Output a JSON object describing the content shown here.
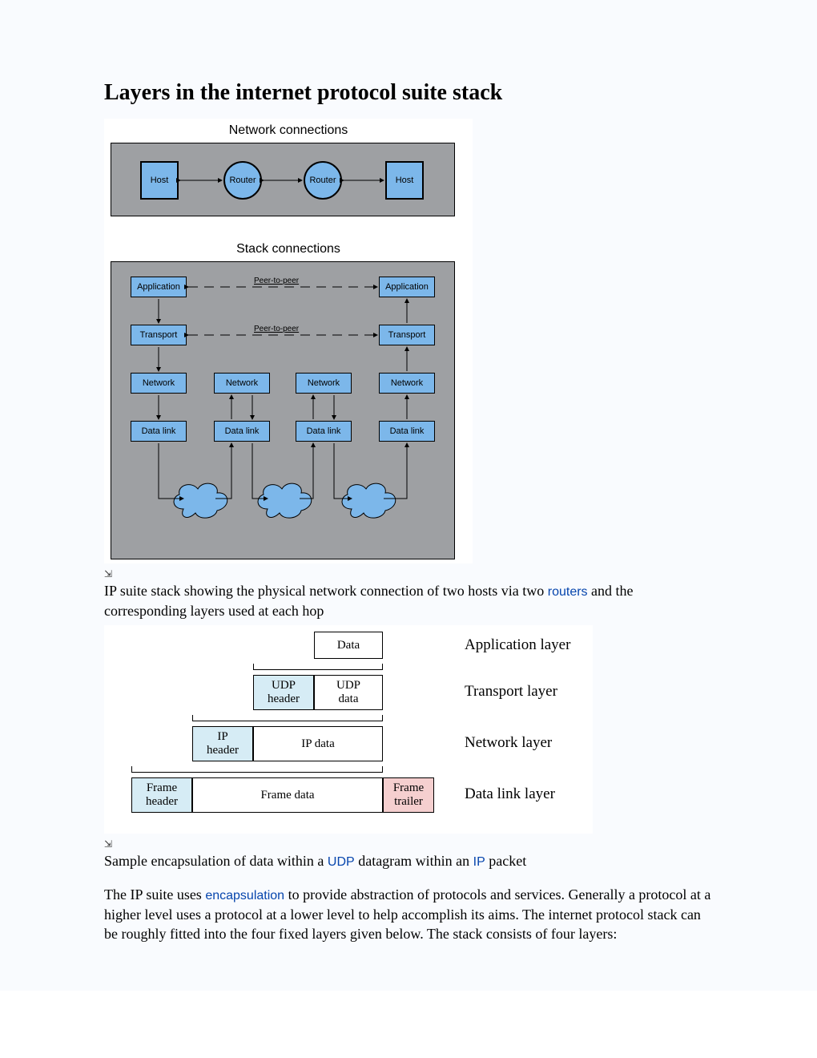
{
  "title": "Layers in the internet protocol suite stack",
  "diagram1": {
    "title_top": "Network connections",
    "title_bottom": "Stack connections",
    "host": "Host",
    "router": "Router",
    "application": "Application",
    "transport": "Transport",
    "network": "Network",
    "datalink": "Data link",
    "peer_label": "Peer-to-peer"
  },
  "caption1_pre": "IP suite stack showing the physical network connection of two hosts via two ",
  "caption1_link": "routers",
  "caption1_post": " and the corresponding layers used at each hop",
  "diagram2": {
    "data": "Data",
    "udp_header": "UDP\nheader",
    "udp_data": "UDP\ndata",
    "ip_header": "IP\nheader",
    "ip_data": "IP data",
    "frame_header": "Frame\nheader",
    "frame_data": "Frame data",
    "frame_trailer": "Frame\ntrailer",
    "label_app": "Application layer",
    "label_transport": "Transport layer",
    "label_network": "Network layer",
    "label_datalink": "Data link layer"
  },
  "caption2_pre": "Sample encapsulation of data within a ",
  "caption2_link1": "UDP",
  "caption2_mid": " datagram within an ",
  "caption2_link2": "IP",
  "caption2_post": " packet",
  "body_pre": "The IP suite uses ",
  "body_link": "encapsulation",
  "body_post": " to provide abstraction of protocols and services. Generally a protocol at a higher level uses a protocol at a lower level to help accomplish its aims. The internet protocol stack can be roughly fitted into the four fixed layers given below. The stack consists of four layers:"
}
